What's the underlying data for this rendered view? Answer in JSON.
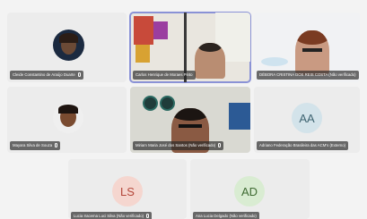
{
  "participants": [
    {
      "name": "Cleide Constantino de Araújo Duarte",
      "type": "photo-avatar"
    },
    {
      "name": "Carlos Henrique de Moraes Pinto",
      "type": "video"
    },
    {
      "name": "DÉBORA CRISTINA DOS REIS COSTA (Não verificado)",
      "type": "video"
    },
    {
      "name": "Mayara Silva de Souza",
      "type": "photo-avatar"
    },
    {
      "name": "Miriam Maria José dos Santos (Não verificado)",
      "type": "video"
    },
    {
      "name": "Adriano Federação Brasileira das ACM's (Externo)",
      "type": "initials",
      "initials": "AA"
    },
    {
      "name": "Lucia Iracema Luci Silva (Não verificado)",
      "type": "initials",
      "initials": "LS"
    },
    {
      "name": "Ana Lucia Delgado (Não verificado)",
      "type": "initials",
      "initials": "AD"
    }
  ],
  "colors": {
    "ls_bg": "#f5d6cf",
    "ls_fg": "#b4473a",
    "ad_bg": "#d9ecd2",
    "ad_fg": "#3f6b33",
    "aa_bg": "#d3e3ea",
    "aa_fg": "#3f6472",
    "active_outline": "#8a92d6"
  }
}
